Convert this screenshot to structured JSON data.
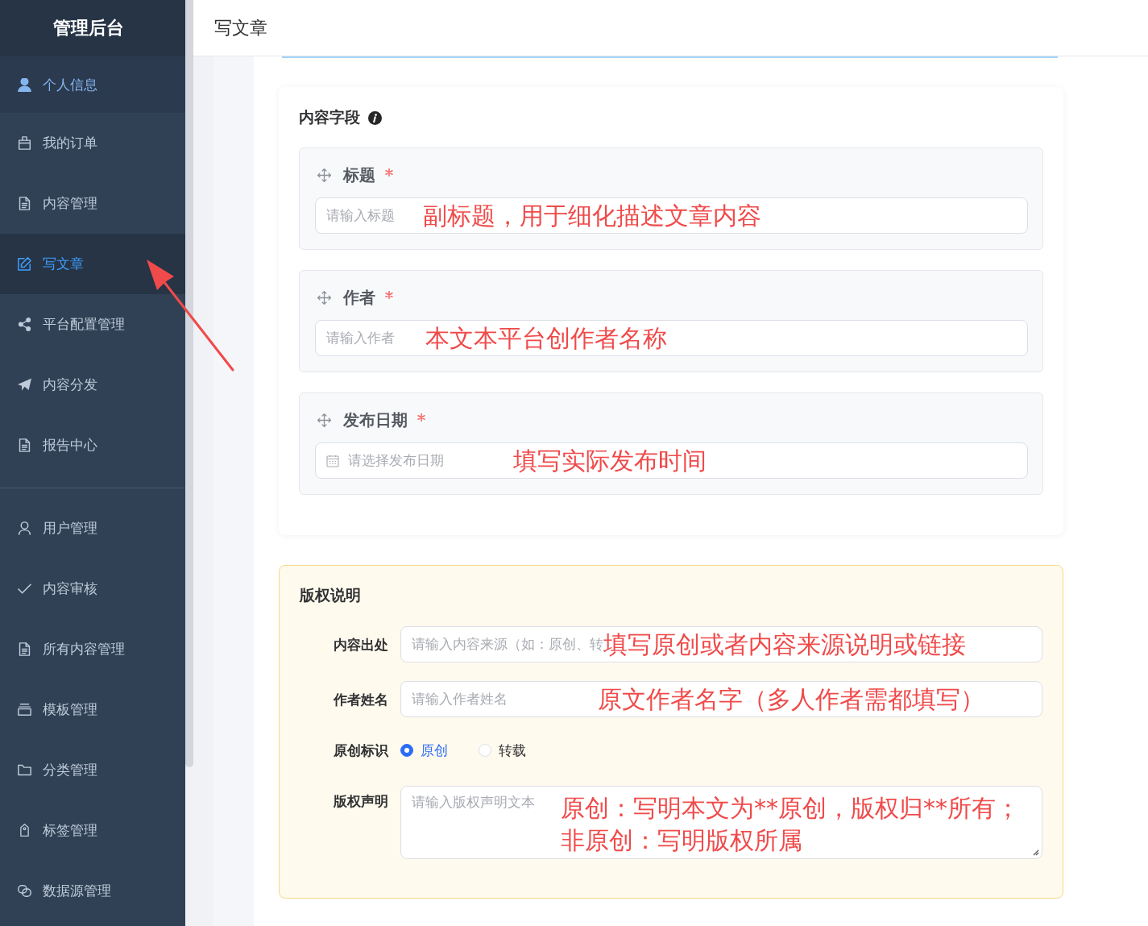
{
  "sidebar": {
    "title": "管理后台",
    "profile": {
      "label": "个人信息"
    },
    "groups": [
      {
        "items": [
          {
            "label": "我的订单",
            "selected": false
          },
          {
            "label": "内容管理",
            "selected": false
          },
          {
            "label": "写文章",
            "selected": true
          },
          {
            "label": "平台配置管理",
            "selected": false
          },
          {
            "label": "内容分发",
            "selected": false
          },
          {
            "label": "报告中心",
            "selected": false
          }
        ]
      },
      {
        "items": [
          {
            "label": "用户管理",
            "selected": false
          },
          {
            "label": "内容审核",
            "selected": false
          },
          {
            "label": "所有内容管理",
            "selected": false
          },
          {
            "label": "模板管理",
            "selected": false
          },
          {
            "label": "分类管理",
            "selected": false
          },
          {
            "label": "标签管理",
            "selected": false
          },
          {
            "label": "数据源管理",
            "selected": false
          }
        ]
      }
    ]
  },
  "header": {
    "title": "写文章"
  },
  "content_fields": {
    "title": "内容字段",
    "fields": [
      {
        "kind": "text",
        "label": "标题",
        "required": true,
        "placeholder": "请输入标题",
        "annotation": "副标题，用于细化描述文章内容"
      },
      {
        "kind": "text",
        "label": "作者",
        "required": true,
        "placeholder": "请输入作者",
        "annotation": "本文本平台创作者名称"
      },
      {
        "kind": "date",
        "label": "发布日期",
        "required": true,
        "placeholder": "请选择发布日期",
        "annotation": "填写实际发布时间"
      }
    ]
  },
  "copyright": {
    "title": "版权说明",
    "rows": [
      {
        "kind": "input",
        "label": "内容出处",
        "placeholder": "请输入内容来源（如：原创、转",
        "annotation": "填写原创或者内容来源说明或链接"
      },
      {
        "kind": "input",
        "label": "作者姓名",
        "placeholder": "请输入作者姓名",
        "annotation": "原文作者名字（多人作者需都填写）"
      },
      {
        "kind": "radio",
        "label": "原创标识",
        "options": [
          {
            "label": "原创",
            "selected": true
          },
          {
            "label": "转载",
            "selected": false
          }
        ]
      },
      {
        "kind": "textarea",
        "label": "版权声明",
        "placeholder": "请输入版权声明文本",
        "annotation_lines": [
          "原创：写明本文为**原创，版权归**所有；",
          "非原创：写明版权所属"
        ]
      }
    ]
  }
}
